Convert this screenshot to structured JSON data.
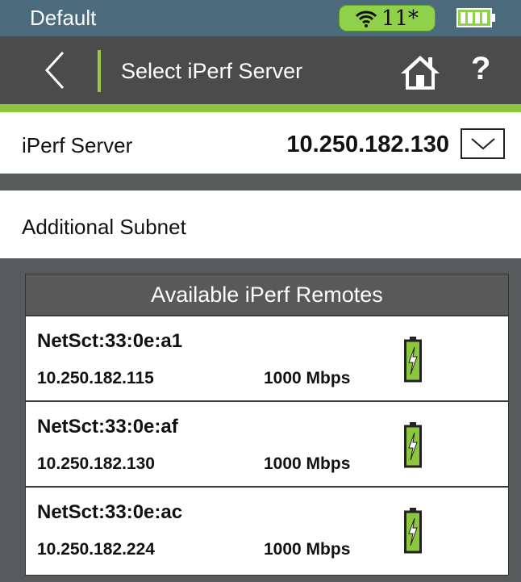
{
  "status_bar": {
    "profile": "Default",
    "wifi_channel": "11*",
    "wifi_icon": "wifi-icon",
    "battery_icon": "battery-full-icon",
    "accent_color": "#8fd14a"
  },
  "nav": {
    "title": "Select iPerf Server",
    "back_icon": "chevron-left-icon",
    "home_icon": "home-icon",
    "help_label": "?"
  },
  "iperf_server": {
    "label": "iPerf Server",
    "value": "10.250.182.130",
    "dropdown_icon": "chevron-down-icon"
  },
  "additional_subnet": {
    "label": "Additional Subnet"
  },
  "remotes": {
    "header": "Available iPerf Remotes",
    "items": [
      {
        "name": "NetSct:33:0e:a1",
        "ip": "10.250.182.115",
        "speed": "1000 Mbps",
        "icon": "battery-charging-icon"
      },
      {
        "name": "NetSct:33:0e:af",
        "ip": "10.250.182.130",
        "speed": "1000 Mbps",
        "icon": "battery-charging-icon"
      },
      {
        "name": "NetSct:33:0e:ac",
        "ip": "10.250.182.224",
        "speed": "1000 Mbps",
        "icon": "battery-charging-icon"
      }
    ]
  }
}
